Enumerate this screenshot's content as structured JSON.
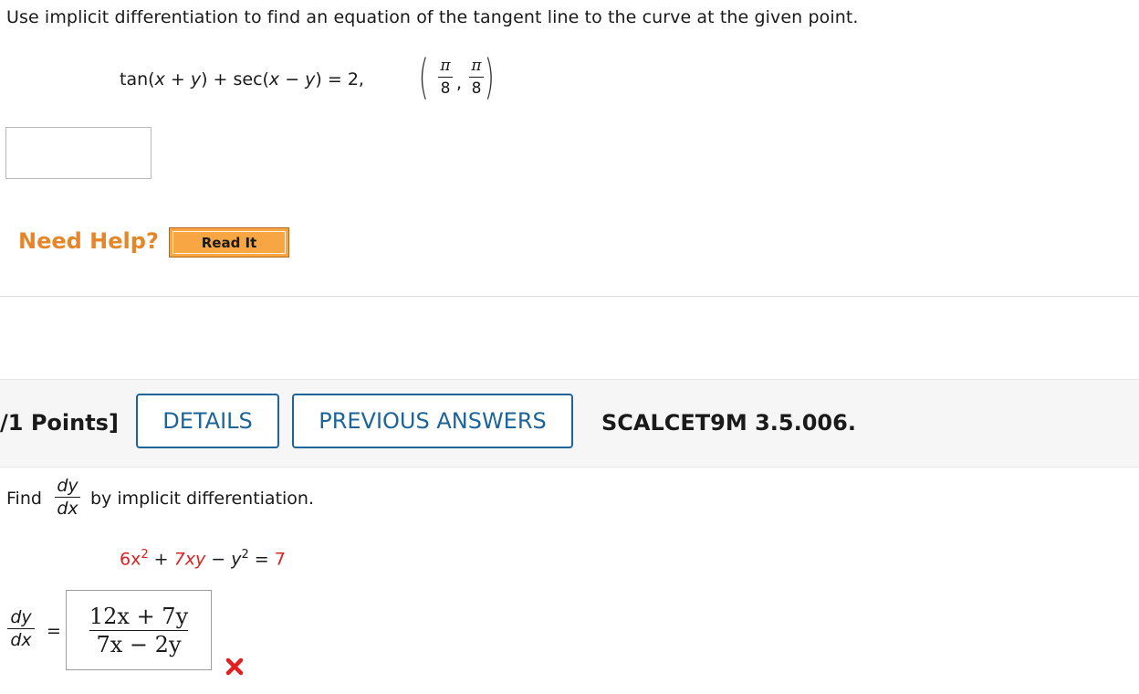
{
  "question1": {
    "instructions": "Use implicit differentiation to find an equation of the tangent line to the curve at the given point.",
    "equation": {
      "part1": "tan(",
      "x": "x",
      "plus": " + ",
      "y": "y",
      "part2": ") + sec(",
      "minus": " − ",
      "part3": ") = 2,"
    },
    "point": {
      "x_num": "π",
      "x_den": "8",
      "y_num": "π",
      "y_den": "8",
      "separator": ","
    },
    "answer_value": "",
    "need_help_label": "Need Help?",
    "read_it_label": "Read It"
  },
  "question2": {
    "points_label": "/1 Points]",
    "details_label": "DETAILS",
    "previous_answers_label": "PREVIOUS ANSWERS",
    "problem_code": "SCALCET9M 3.5.006.",
    "find_label": "Find",
    "dy": "dy",
    "dx": "dx",
    "instruction_rest": "by implicit differentiation.",
    "equation": {
      "t1": "6x",
      "t1_exp": "2",
      "op1": " + ",
      "t2": "7xy",
      "op2": " − ",
      "t3": "y",
      "t3_exp": "2",
      "eq": " = ",
      "rhs": "7"
    },
    "lhs_equals": "=",
    "answer": {
      "numerator": "12x + 7y",
      "denominator": "7x − 2y"
    },
    "status": "incorrect",
    "colors": {
      "highlight": "#e02020",
      "incorrect_mark": "#e02020"
    }
  },
  "colors": {
    "help_orange": "#e5862b",
    "read_it_button": "#f7a643",
    "button_blue": "#1d6499"
  }
}
